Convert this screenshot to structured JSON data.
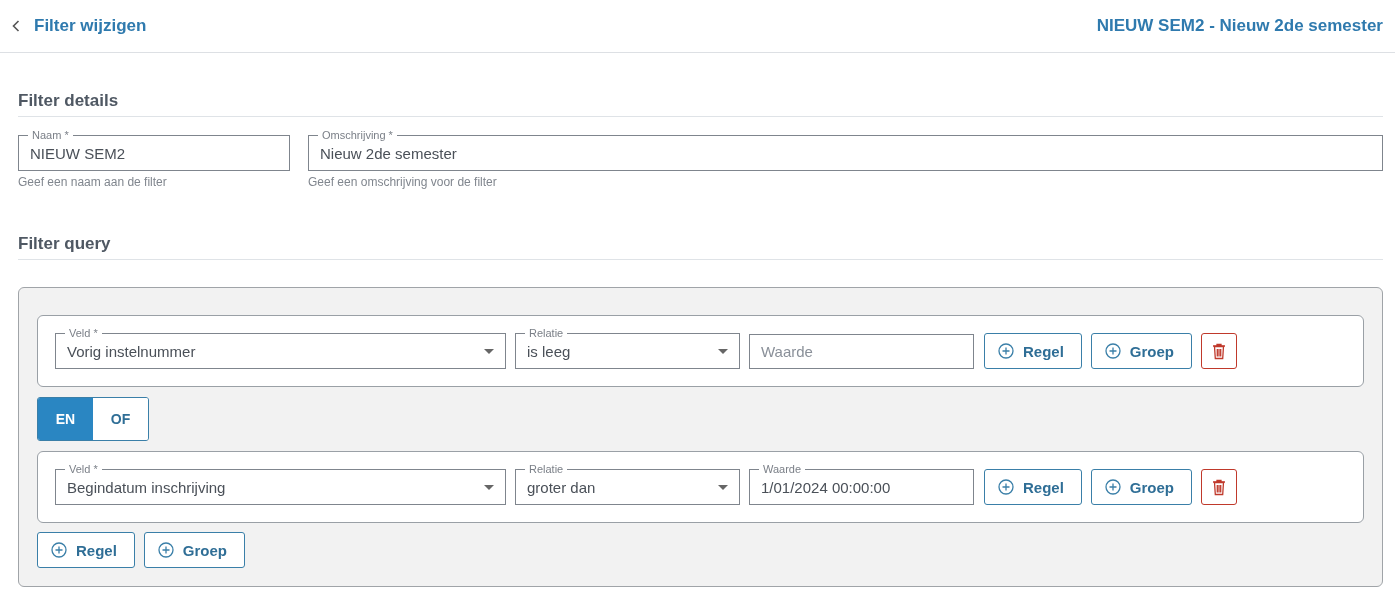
{
  "header": {
    "back_label": "Filter wijzigen",
    "title": "NIEUW SEM2 - Nieuw 2de semester"
  },
  "details": {
    "heading": "Filter details",
    "fields": [
      {
        "label": "Naam *",
        "value": "NIEUW SEM2",
        "helper": "Geef een naam aan de filter"
      },
      {
        "label": "Omschrijving *",
        "value": "Nieuw 2de semester",
        "helper": "Geef een omschrijving voor de filter"
      }
    ]
  },
  "query": {
    "heading": "Filter query",
    "items": [
      {
        "kind": "rule",
        "field": {
          "label": "Veld *",
          "value": "Vorig instelnummer"
        },
        "relation": {
          "label": "Relatie",
          "value": "is leeg"
        },
        "value": {
          "placeholder": "Waarde"
        },
        "buttons": [
          "Regel",
          "Groep"
        ]
      },
      {
        "kind": "connector",
        "options": [
          {
            "label": "EN",
            "selected": true
          },
          {
            "label": "OF",
            "selected": false
          }
        ]
      },
      {
        "kind": "rule",
        "field": {
          "label": "Veld *",
          "value": "Begindatum inschrijving"
        },
        "relation": {
          "label": "Relatie",
          "value": "groter dan"
        },
        "value": {
          "label": "Waarde",
          "value": "1/01/2024 00:00:00"
        },
        "buttons": [
          "Regel",
          "Groep"
        ]
      }
    ],
    "buttons": [
      "Regel",
      "Groep"
    ]
  }
}
